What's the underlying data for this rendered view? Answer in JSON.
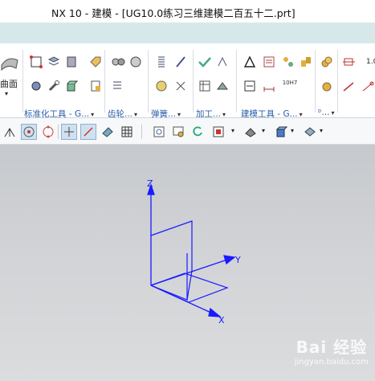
{
  "window": {
    "title": "NX 10 - 建模 - [UG10.0练习三维建模二百五十二.prt]"
  },
  "ribbon": {
    "left_group": {
      "label": "曲面"
    },
    "groups": [
      {
        "label": "标准化工具 - G...",
        "has_dropdown": true
      },
      {
        "label": "齿轮...",
        "has_dropdown": true
      },
      {
        "label": "弹簧...",
        "has_dropdown": true
      },
      {
        "label": "加工...",
        "has_dropdown": true
      },
      {
        "label": "建模工具 - G...",
        "has_dropdown": true
      },
      {
        "label": "ᵖ...",
        "has_dropdown": true
      }
    ],
    "small_texts": {
      "h7": "10H7",
      "right_num": "1.0"
    }
  },
  "viewport": {
    "axes": {
      "z": "Z",
      "y": "Y",
      "x": "X"
    },
    "colors": {
      "model": "#1a1aff",
      "background": "#cbcdd0"
    }
  },
  "watermark": {
    "main": "Bai 经验",
    "sub": "jingyan.baidu.com"
  }
}
